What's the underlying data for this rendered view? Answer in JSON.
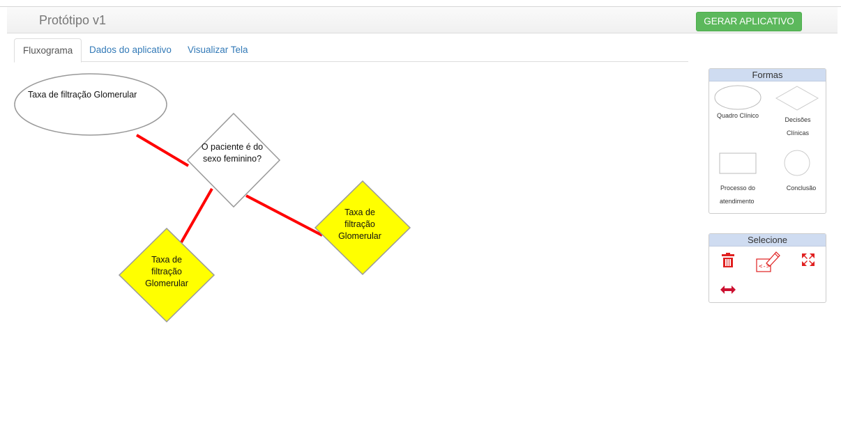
{
  "header": {
    "title": "Protótipo v1",
    "generate_button": "GERAR APLICATIVO"
  },
  "tabs": [
    {
      "label": "Fluxograma",
      "active": true
    },
    {
      "label": "Dados do aplicativo",
      "active": false
    },
    {
      "label": "Visualizar Tela",
      "active": false
    }
  ],
  "flowchart": {
    "start_node": "Taxa de filtração Glomerular",
    "decision_node_line1": "O paciente é do",
    "decision_node_line2": "sexo feminino?",
    "conclusion_left": {
      "line1": "Taxa de",
      "line2": "filtração",
      "line3": "Glomerular"
    },
    "conclusion_right": {
      "line1": "Taxa de",
      "line2": "filtração",
      "line3": "Glomerular"
    },
    "connector_color": "#ff0000",
    "highlight_color": "#ffff00"
  },
  "shapes_panel": {
    "title": "Formas",
    "items": {
      "clinical_picture": "Quadro Clínico",
      "clinical_decisions_line1": "Decisões",
      "clinical_decisions_line2": "Clínicas",
      "care_process_line1": "Processo do",
      "care_process_line2": "atendimento",
      "conclusion": "Conclusão"
    }
  },
  "select_panel": {
    "title": "Selecione",
    "tools": [
      "trash-icon",
      "edit-code-icon",
      "expand-icon",
      "resize-horizontal-icon"
    ]
  }
}
